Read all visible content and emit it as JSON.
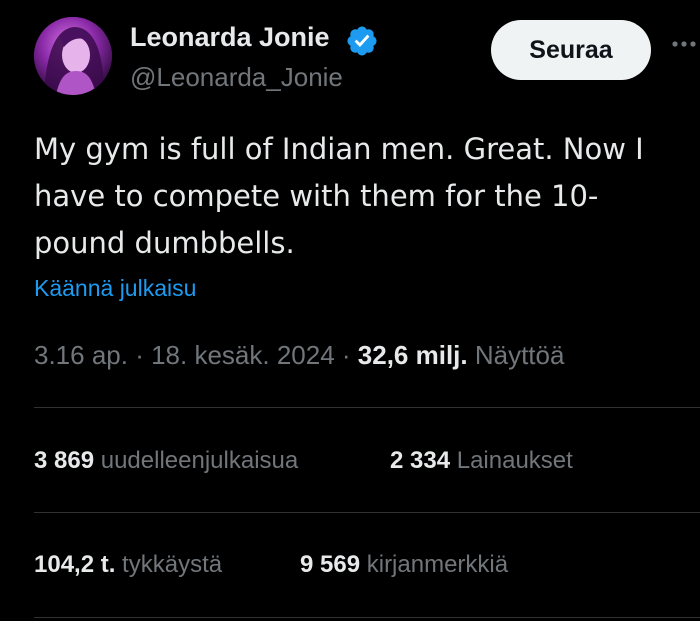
{
  "author": {
    "display_name": "Leonarda Jonie",
    "handle": "@Leonarda_Jonie",
    "verified": true,
    "avatar_icon": "profile-photo"
  },
  "actions": {
    "follow_label": "Seuraa",
    "more_icon": "more-horizontal-icon"
  },
  "tweet": {
    "text_lines": [
      "My gym is full of Indian men. Great. Now I",
      "have to compete with them for the 10-",
      "pound dumbbells."
    ],
    "translate_label": "Käännä julkaisu"
  },
  "meta": {
    "time": "3.16 ap.",
    "sep1": " · ",
    "date": "18. kesäk. 2024",
    "sep2": " · ",
    "views_count": "32,6 milj.",
    "views_label": " Näyttöä"
  },
  "stats": {
    "reposts": {
      "count": "3 869",
      "label": " uudelleenjulkaisua"
    },
    "quotes": {
      "count": "2 334",
      "label": " Lainaukset"
    },
    "likes": {
      "count": "104,2 t.",
      "label": " tykkäystä"
    },
    "bookmarks": {
      "count": "9 569",
      "label": " kirjanmerkkiä"
    }
  },
  "colors": {
    "background": "#000000",
    "text_primary": "#e7e9ea",
    "text_secondary": "#71767b",
    "link": "#1d9bf0",
    "verified_badge": "#1d9bf0",
    "divider": "#2f3336",
    "button_bg": "#eff3f4"
  }
}
